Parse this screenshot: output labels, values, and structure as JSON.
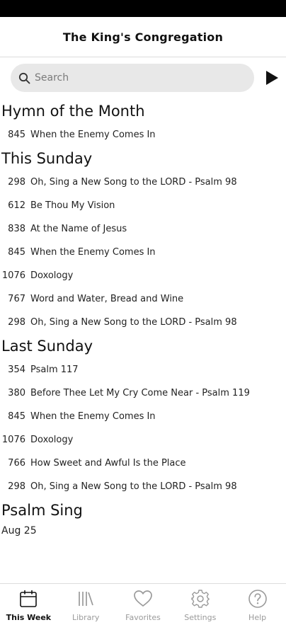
{
  "header": {
    "title": "The King's Congregation"
  },
  "search": {
    "placeholder": "Search"
  },
  "sections": {
    "hymn_of_month": {
      "title": "Hymn of the Month",
      "items": [
        {
          "number": "845",
          "title": "When the Enemy Comes In"
        }
      ]
    },
    "this_sunday": {
      "title": "This Sunday",
      "items": [
        {
          "number": "298",
          "title": "Oh, Sing a New Song to the LORD - Psalm 98"
        },
        {
          "number": "612",
          "title": "Be Thou My Vision"
        },
        {
          "number": "838",
          "title": "At the Name of Jesus"
        },
        {
          "number": "845",
          "title": "When the Enemy Comes In"
        },
        {
          "number": "1076",
          "title": "Doxology"
        },
        {
          "number": "767",
          "title": "Word and Water, Bread and Wine"
        },
        {
          "number": "298",
          "title": "Oh, Sing a New Song to the LORD - Psalm 98"
        }
      ]
    },
    "last_sunday": {
      "title": "Last Sunday",
      "items": [
        {
          "number": "354",
          "title": "Psalm 117"
        },
        {
          "number": "380",
          "title": "Before Thee Let My Cry Come Near - Psalm 119"
        },
        {
          "number": "845",
          "title": "When the Enemy Comes In"
        },
        {
          "number": "1076",
          "title": "Doxology"
        },
        {
          "number": "766",
          "title": "How Sweet and Awful Is the Place"
        },
        {
          "number": "298",
          "title": "Oh, Sing a New Song to the LORD - Psalm 98"
        }
      ]
    },
    "psalm_sing": {
      "title": "Psalm Sing",
      "date": "Aug 25"
    }
  },
  "tabs": [
    {
      "label": "This Week",
      "icon": "calendar-icon",
      "active": true
    },
    {
      "label": "Library",
      "icon": "library-icon",
      "active": false
    },
    {
      "label": "Favorites",
      "icon": "heart-icon",
      "active": false
    },
    {
      "label": "Settings",
      "icon": "gear-icon",
      "active": false
    },
    {
      "label": "Help",
      "icon": "help-icon",
      "active": false
    }
  ]
}
